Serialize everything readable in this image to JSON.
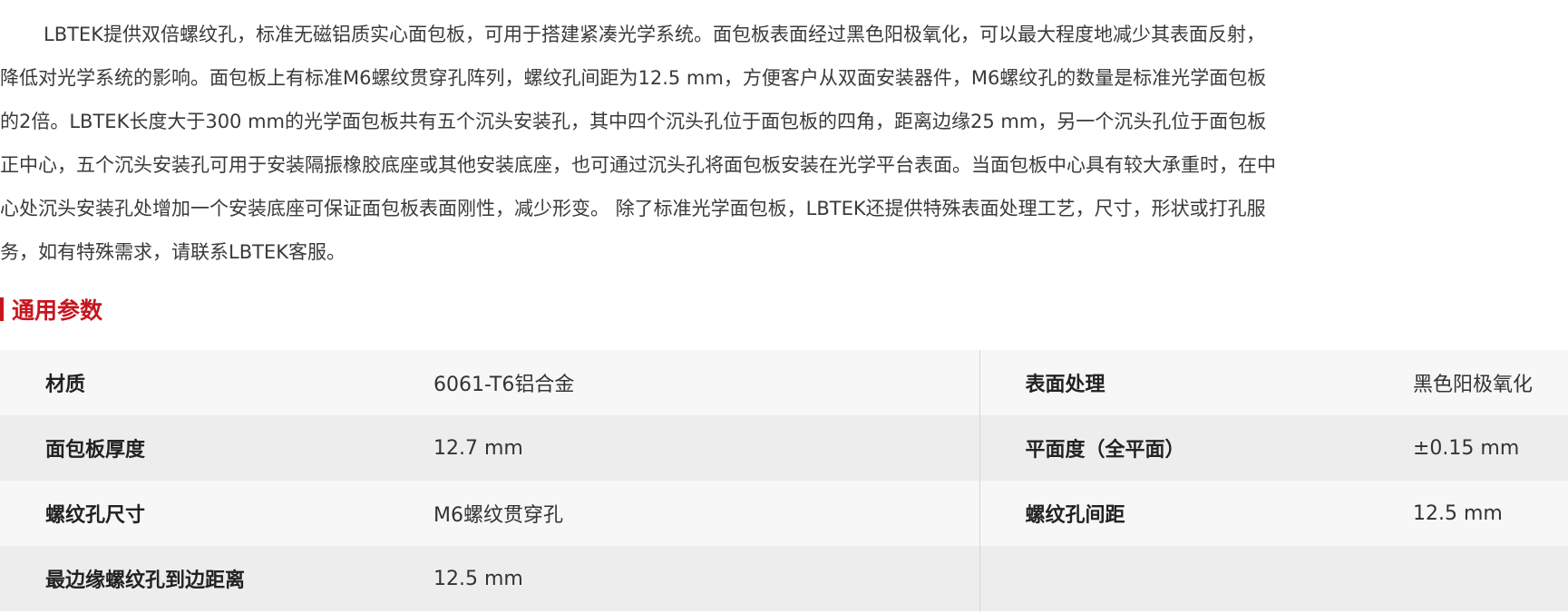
{
  "intro": {
    "paragraph": "LBTEK提供双倍螺纹孔，标准无磁铝质实心面包板，可用于搭建紧凑光学系统。面包板表面经过黑色阳极氧化，可以最大程度地减少其表面反射，降低对光学系统的影响。面包板上有标准M6螺纹贯穿孔阵列，螺纹孔间距为12.5 mm，方便客户从双面安装器件，M6螺纹孔的数量是标准光学面包板的2倍。LBTEK长度大于300 mm的光学面包板共有五个沉头安装孔，其中四个沉头孔位于面包板的四角，距离边缘25 mm，另一个沉头孔位于面包板正中心，五个沉头安装孔可用于安装隔振橡胶底座或其他安装底座，也可通过沉头孔将面包板安装在光学平台表面。当面包板中心具有较大承重时，在中心处沉头安装孔处增加一个安装底座可保证面包板表面刚性，减少形变。 除了标准光学面包板，LBTEK还提供特殊表面处理工艺，尺寸，形状或打孔服务，如有特殊需求，请联系LBTEK客服。"
  },
  "section": {
    "title": "通用参数",
    "accent_color": "#c8141e"
  },
  "params": {
    "rows": [
      {
        "label1": "材质",
        "value1": "6061-T6铝合金",
        "label2": "表面处理",
        "value2": "黑色阳极氧化"
      },
      {
        "label1": "面包板厚度",
        "value1": "12.7 mm",
        "label2": "平面度（全平面）",
        "value2": "±0.15 mm"
      },
      {
        "label1": "螺纹孔尺寸",
        "value1": "M6螺纹贯穿孔",
        "label2": "螺纹孔间距",
        "value2": "12.5 mm"
      },
      {
        "label1": "最边缘螺纹孔到边距离",
        "value1": "12.5 mm",
        "label2": "",
        "value2": ""
      }
    ]
  }
}
